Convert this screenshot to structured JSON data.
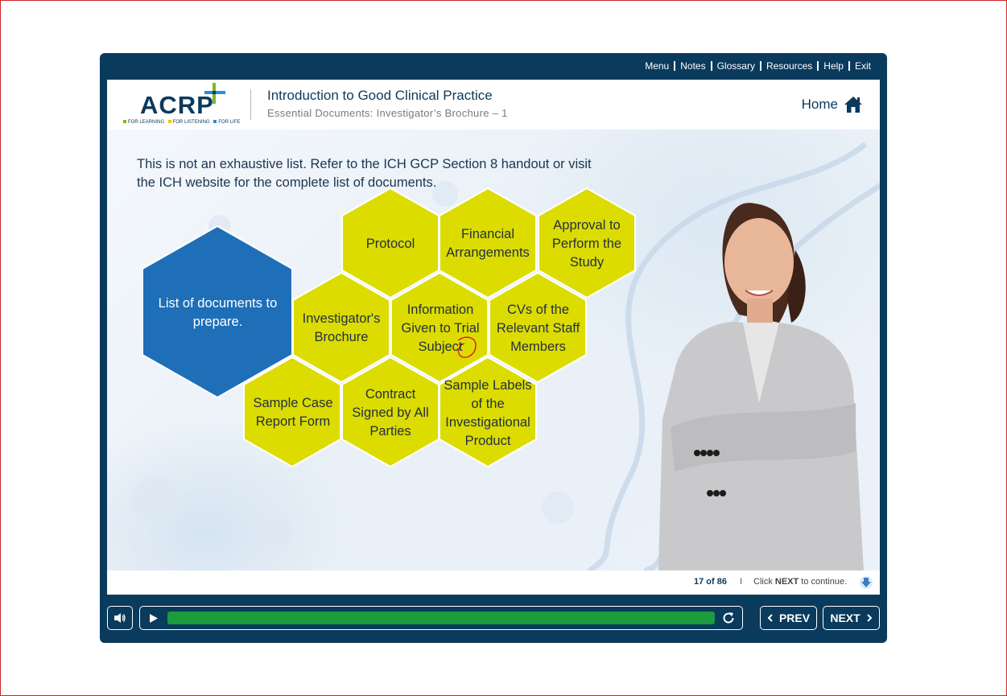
{
  "topnav": {
    "items": [
      "Menu",
      "Notes",
      "Glossary",
      "Resources",
      "Help",
      "Exit"
    ]
  },
  "header": {
    "logo_text": "ACRP",
    "logo_tagline": [
      "FOR LEARNING",
      "FOR LISTENING",
      "FOR LIFE"
    ],
    "course_title": "Introduction to Good Clinical Practice",
    "course_subtitle": "Essential Documents: Investigator’s Brochure – 1",
    "home_label": "Home"
  },
  "content": {
    "instruction": "This is not an exhaustive list. Refer to the ICH GCP Section 8 handout or visit the ICH website for the complete list of documents.",
    "main_hex": "List of documents to prepare.",
    "hexagons": [
      "Protocol",
      "Financial Arrangements",
      "Approval to Perform the Study",
      "Investigator's Brochure",
      "Information Given to Trial Subject",
      "CVs of the Relevant Staff Members",
      "Sample Case Report Form",
      "Contract Signed by All Parties",
      "Sample Labels of the Investigational Product"
    ]
  },
  "footer": {
    "page_indicator": "17 of 86",
    "separator": "I",
    "continue_prefix": "Click ",
    "continue_bold": "NEXT",
    "continue_suffix": " to continue."
  },
  "controls": {
    "prev_label": "PREV",
    "next_label": "NEXT",
    "progress": 1.0
  },
  "colors": {
    "frame": "#0a3a5c",
    "hex_yellow": "#dcdc00",
    "hex_blue": "#1e6fb8",
    "progress_green": "#1b9b3c"
  },
  "icons": {
    "home": "home-icon",
    "volume": "volume-icon",
    "play": "play-icon",
    "replay": "replay-icon",
    "down": "down-arrow-icon"
  }
}
